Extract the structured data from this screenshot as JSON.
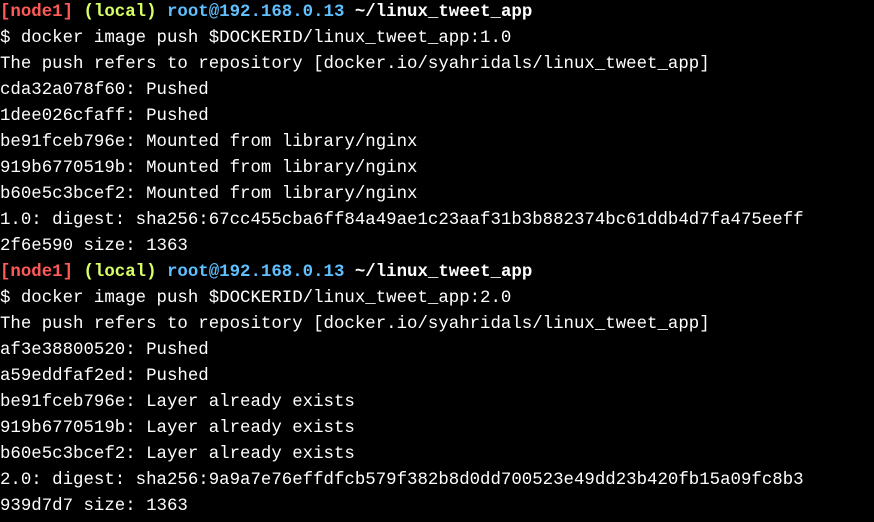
{
  "colors": {
    "background": "#000000",
    "text": "#ffffff",
    "node": "#ff5a5a",
    "local": "#d7ff66",
    "user_host": "#5fbfff"
  },
  "blocks": [
    {
      "prompt": {
        "node": "[node1]",
        "local": "(local)",
        "user_host": "root@192.168.0.13",
        "path": "~/linux_tweet_app"
      },
      "command": "$ docker image push $DOCKERID/linux_tweet_app:1.0",
      "output": [
        "The push refers to repository [docker.io/syahridals/linux_tweet_app]",
        "cda32a078f60: Pushed",
        "1dee026cfaff: Pushed",
        "be91fceb796e: Mounted from library/nginx",
        "919b6770519b: Mounted from library/nginx",
        "b60e5c3bcef2: Mounted from library/nginx",
        "1.0: digest: sha256:67cc455cba6ff84a49ae1c23aaf31b3b882374bc61ddb4d7fa475eeff",
        "2f6e590 size: 1363"
      ]
    },
    {
      "prompt": {
        "node": "[node1]",
        "local": "(local)",
        "user_host": "root@192.168.0.13",
        "path": "~/linux_tweet_app"
      },
      "command": "$ docker image push $DOCKERID/linux_tweet_app:2.0",
      "output": [
        "The push refers to repository [docker.io/syahridals/linux_tweet_app]",
        "af3e38800520: Pushed",
        "a59eddfaf2ed: Pushed",
        "be91fceb796e: Layer already exists",
        "919b6770519b: Layer already exists",
        "b60e5c3bcef2: Layer already exists",
        "2.0: digest: sha256:9a9a7e76effdfcb579f382b8d0dd700523e49dd23b420fb15a09fc8b3",
        "939d7d7 size: 1363"
      ]
    }
  ]
}
